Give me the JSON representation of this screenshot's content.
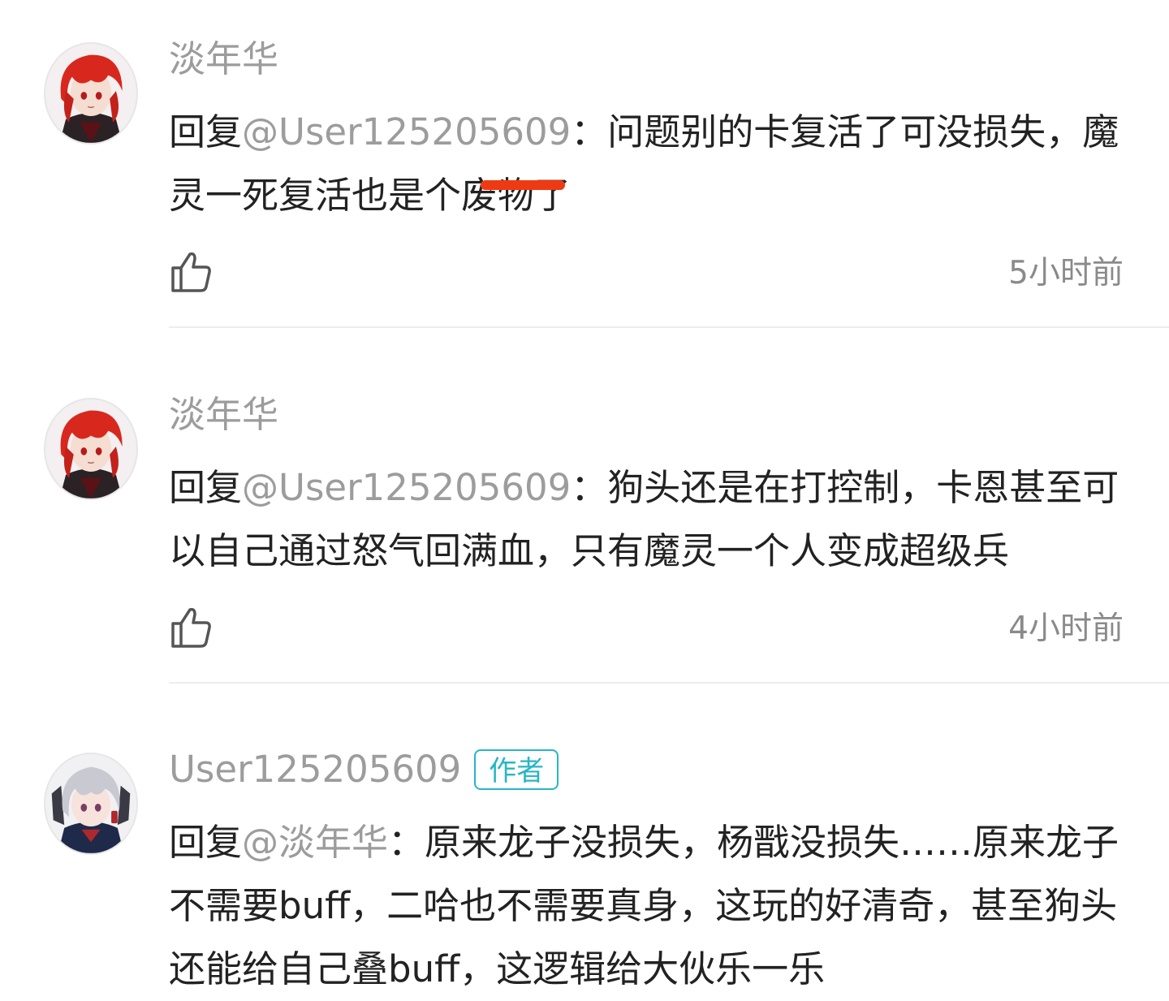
{
  "comments": [
    {
      "avatar": "red-haired-anime-character-avatar",
      "username": "淡年华",
      "reply_prefix": "回复",
      "mention": "@User125205609",
      "text_before": "：问题别的卡复活了可没损失，魔灵一死复活也是个",
      "censored_text": "废物",
      "text_after": "了",
      "timestamp": "5小时前",
      "like_icon": "thumbs-up-icon"
    },
    {
      "avatar": "red-haired-anime-character-avatar",
      "username": "淡年华",
      "reply_prefix": "回复",
      "mention": "@User125205609",
      "text": "：狗头还是在打控制，卡恩甚至可以自己通过怒气回满血，只有魔灵一个人变成超级兵",
      "timestamp": "4小时前",
      "like_icon": "thumbs-up-icon"
    },
    {
      "avatar": "silver-haired-anime-character-avatar",
      "username": "User125205609",
      "badge": "作者",
      "reply_prefix": "回复",
      "mention": "@淡年华",
      "text": "：原来龙子没损失，杨戬没损失……原来龙子不需要buff，二哈也不需要真身，这玩的好清奇，甚至狗头还能给自己叠buff，这逻辑给大伙乐一乐"
    }
  ],
  "colors": {
    "username": "#9c9c9c",
    "mention": "#9c9c9c",
    "body_text": "#222222",
    "timestamp": "#8a8a8a",
    "author_badge": "#27b6c4",
    "censor_bar": "#ee3a12",
    "divider": "#ededed"
  }
}
